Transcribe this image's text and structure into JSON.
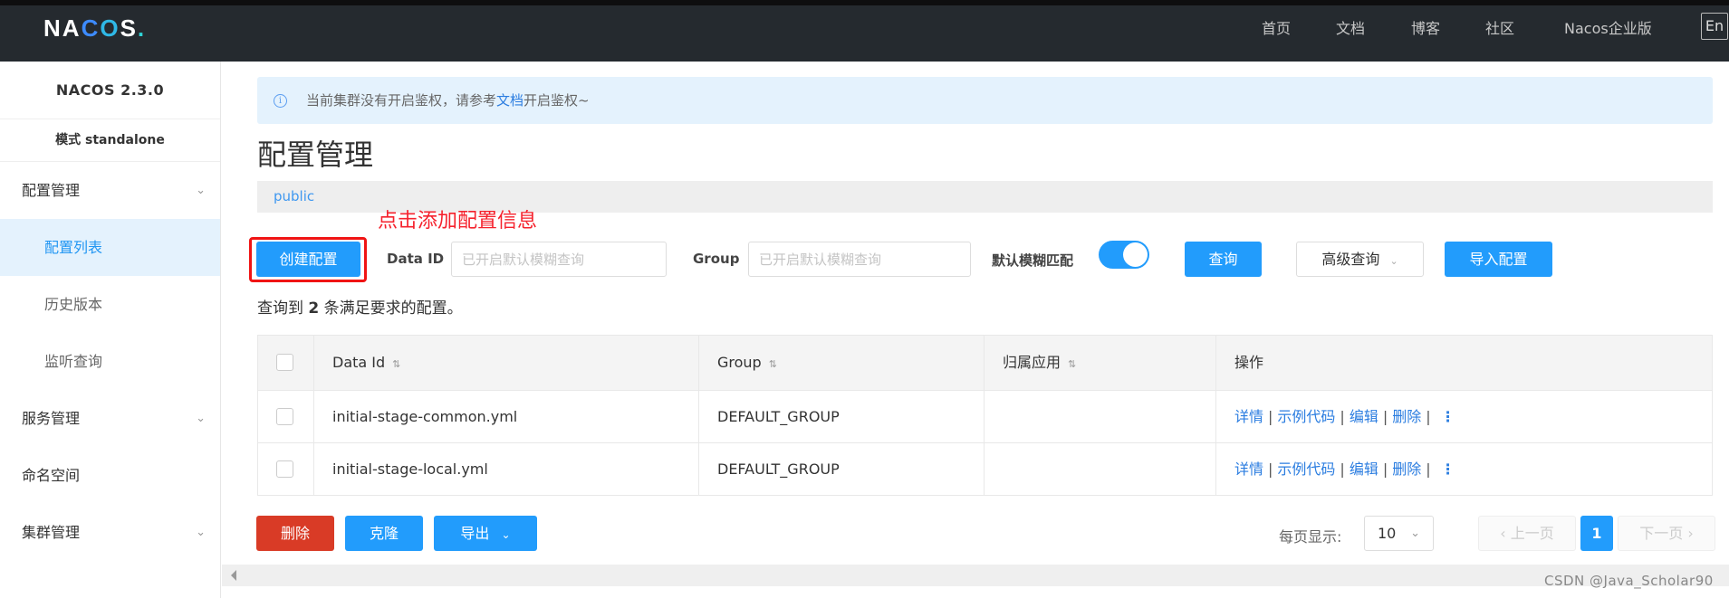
{
  "header": {
    "logo": {
      "part1": "NA",
      "part2": "C",
      "part3": "O",
      "part4": "S",
      "dot": "."
    },
    "nav": [
      "首页",
      "文档",
      "博客",
      "社区",
      "Nacos企业版"
    ],
    "lang": "En"
  },
  "sidebar": {
    "version": "NACOS 2.3.0",
    "mode": "模式 standalone",
    "items": [
      {
        "label": "配置管理",
        "type": "group",
        "icon": "chevron-down-icon"
      },
      {
        "label": "配置列表",
        "type": "sub",
        "active": true
      },
      {
        "label": "历史版本",
        "type": "sub"
      },
      {
        "label": "监听查询",
        "type": "sub"
      },
      {
        "label": "服务管理",
        "type": "group",
        "icon": "chevron-down-icon"
      },
      {
        "label": "命名空间",
        "type": "item"
      },
      {
        "label": "集群管理",
        "type": "group",
        "icon": "chevron-down-icon"
      }
    ]
  },
  "alert": {
    "icon": "info-icon",
    "text_before": "当前集群没有开启鉴权，请参考",
    "link": "文档",
    "text_after": "开启鉴权~"
  },
  "page_title": "配置管理",
  "namespace": "public",
  "annotation": "点击添加配置信息",
  "toolbar": {
    "create_label": "创建配置",
    "data_id_label": "Data ID",
    "data_id_placeholder": "已开启默认模糊查询",
    "data_id_value": "",
    "group_label": "Group",
    "group_placeholder": "已开启默认模糊查询",
    "group_value": "",
    "fuzzy_label": "默认模糊匹配",
    "fuzzy_enabled": true,
    "search_label": "查询",
    "advanced_label": "高级查询",
    "import_label": "导入配置"
  },
  "result": {
    "prefix": "查询到",
    "count": "2",
    "suffix": "条满足要求的配置。"
  },
  "table": {
    "columns": [
      "Data Id",
      "Group",
      "归属应用",
      "操作"
    ],
    "rows": [
      {
        "data_id": "initial-stage-common.yml",
        "group": "DEFAULT_GROUP",
        "app": ""
      },
      {
        "data_id": "initial-stage-local.yml",
        "group": "DEFAULT_GROUP",
        "app": ""
      }
    ],
    "actions": [
      "详情",
      "示例代码",
      "编辑",
      "删除"
    ],
    "more_icon": "more-vertical-icon"
  },
  "bottom": {
    "delete_label": "删除",
    "clone_label": "克隆",
    "export_label": "导出",
    "page_size_label": "每页显示:",
    "page_size": "10",
    "prev_label": "上一页",
    "current_page": "1",
    "next_label": "下一页"
  },
  "watermark": "CSDN @Java_Scholar90"
}
